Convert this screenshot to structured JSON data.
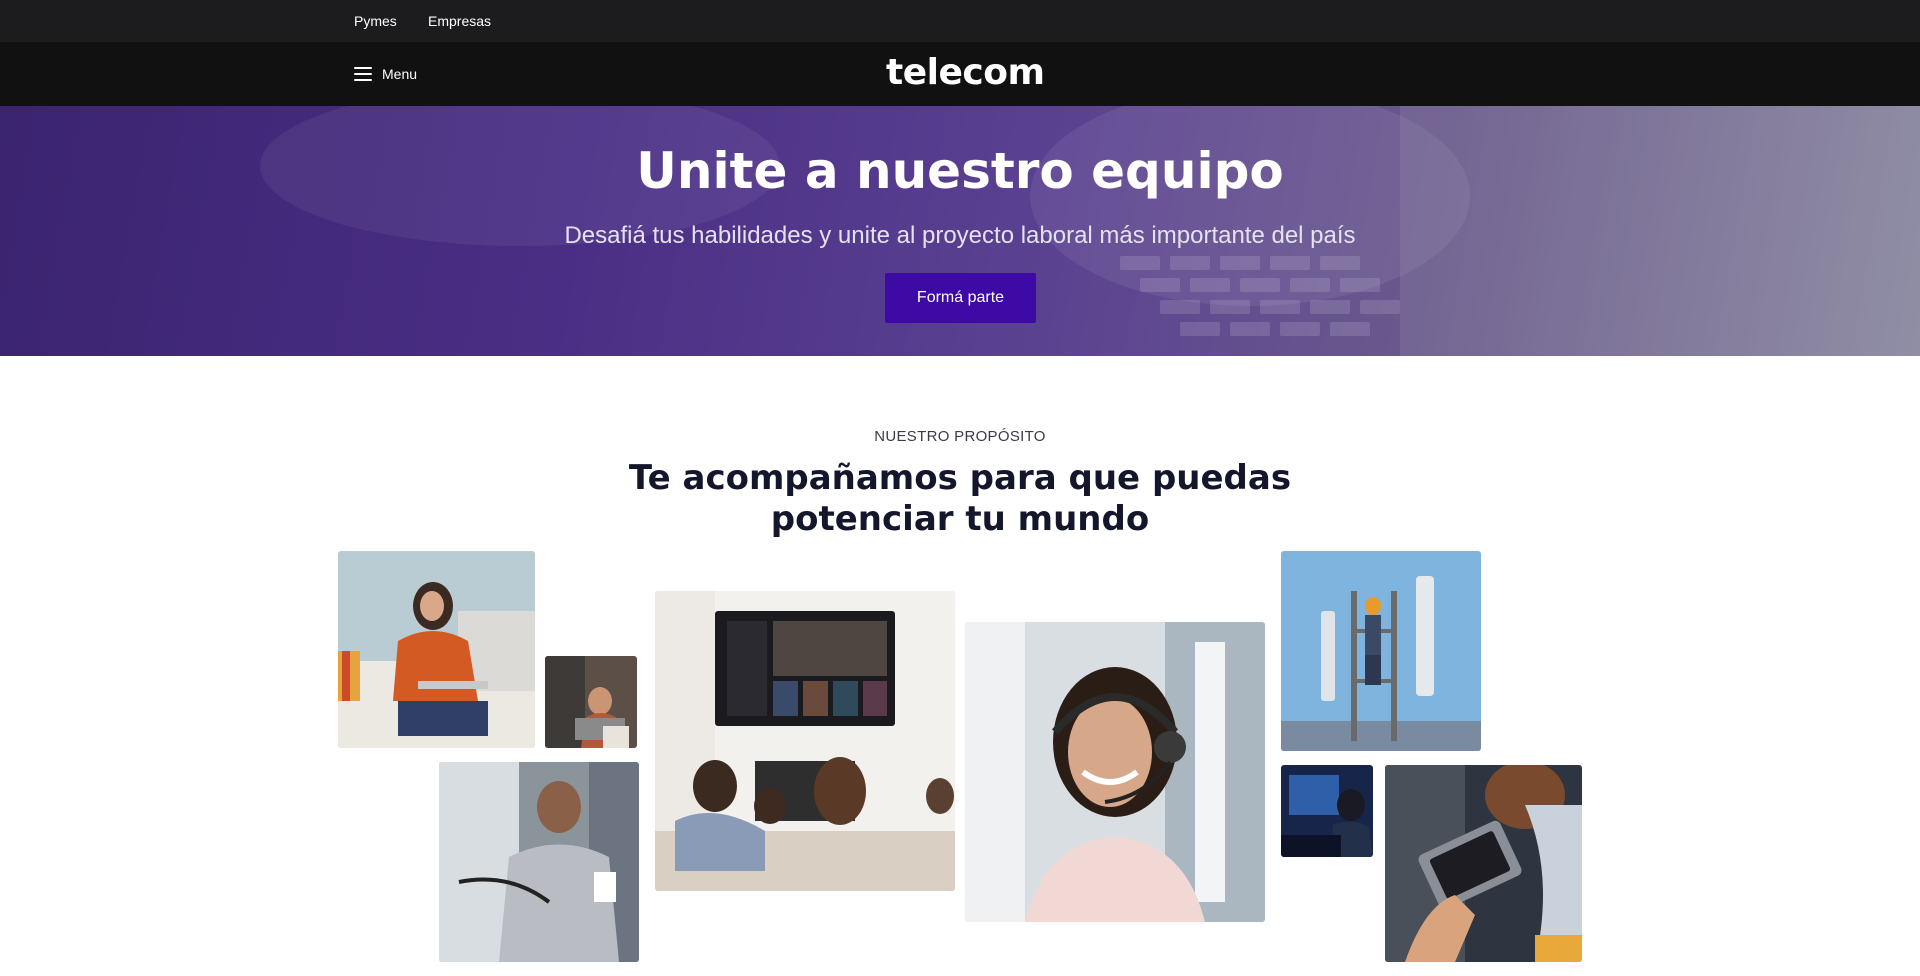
{
  "topbar": {
    "links": [
      "Pymes",
      "Empresas"
    ]
  },
  "header": {
    "menu_label": "Menu",
    "logo_text": "telecom",
    "menu_icon": "hamburger-icon"
  },
  "hero": {
    "title": "Unite a nuestro equipo",
    "subtitle": "Desafiá tus habilidades y unite al proyecto laboral más importante del país",
    "cta_label": "Formá parte"
  },
  "purpose": {
    "eyebrow": "NUESTRO PROPÓSITO",
    "title_line1": "Te acompañamos para que puedas",
    "title_line2": "potenciar tu mundo"
  },
  "photos": [
    {
      "name": "photo-woman-laptop-sofa"
    },
    {
      "name": "photo-child-video-call"
    },
    {
      "name": "photo-technician-fiber"
    },
    {
      "name": "photo-family-watching-tv"
    },
    {
      "name": "photo-call-center-agent"
    },
    {
      "name": "photo-antenna-worker"
    },
    {
      "name": "photo-gamer-monitor"
    },
    {
      "name": "photo-phone-streaming"
    }
  ],
  "colors": {
    "topbar": "#1c1c1e",
    "header": "#111111",
    "cta": "#3d0aa6",
    "hero": "#4a2e85",
    "title": "#14172b"
  }
}
